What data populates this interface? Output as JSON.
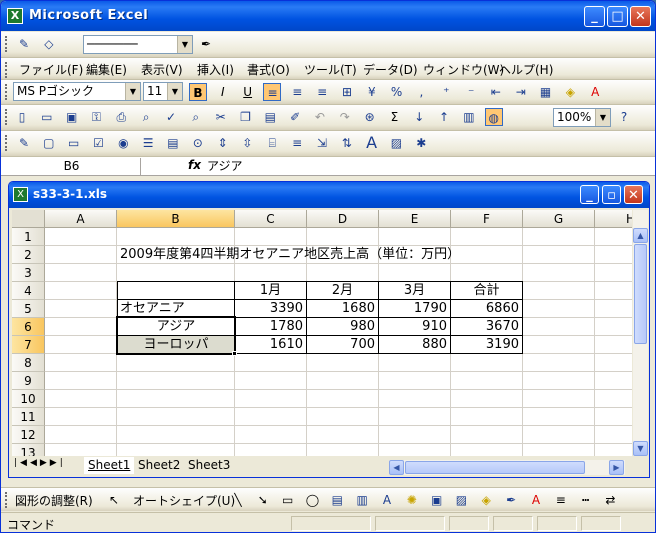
{
  "app": {
    "title": "Microsoft Excel"
  },
  "toolbar_line": {
    "style_label": "───────"
  },
  "menu": [
    "ファイル(F)",
    "編集(E)",
    "表示(V)",
    "挿入(I)",
    "書式(O)",
    "ツール(T)",
    "データ(D)",
    "ウィンドウ(W)",
    "ヘルプ(H)"
  ],
  "format": {
    "font": "MS Pゴシック",
    "size": "11",
    "bold": "B",
    "italic": "I",
    "underline": "U",
    "percent": "%",
    "comma": ","
  },
  "standard": {
    "zoom": "100%"
  },
  "formula_bar": {
    "name_box": "B6",
    "fx": "fx",
    "content": "アジア"
  },
  "document": {
    "title": "s33-3-1.xls"
  },
  "columns": [
    "A",
    "B",
    "C",
    "D",
    "E",
    "F",
    "G",
    "H"
  ],
  "rows": [
    "1",
    "2",
    "3",
    "4",
    "5",
    "6",
    "7",
    "8",
    "9",
    "10",
    "11",
    "12",
    "13"
  ],
  "sheet": {
    "title": "2009年度第4四半期オセアニア地区売上高（単位：万円）",
    "headers": [
      "1月",
      "2月",
      "3月",
      "合計"
    ],
    "region": {
      "label": "オセアニア",
      "values": [
        "3390",
        "1680",
        "1790",
        "6860"
      ]
    },
    "asia": {
      "label": "アジア",
      "values": [
        "1780",
        "980",
        "910",
        "3670"
      ]
    },
    "europe": {
      "label": "ヨーロッパ",
      "values": [
        "1610",
        "700",
        "880",
        "3190"
      ]
    }
  },
  "sheet_tabs": [
    "Sheet1",
    "Sheet2",
    "Sheet3"
  ],
  "drawing": {
    "adjust": "図形の調整(R)",
    "autoshape": "オートシェイプ(U)"
  },
  "status": {
    "text": "コマンド"
  }
}
